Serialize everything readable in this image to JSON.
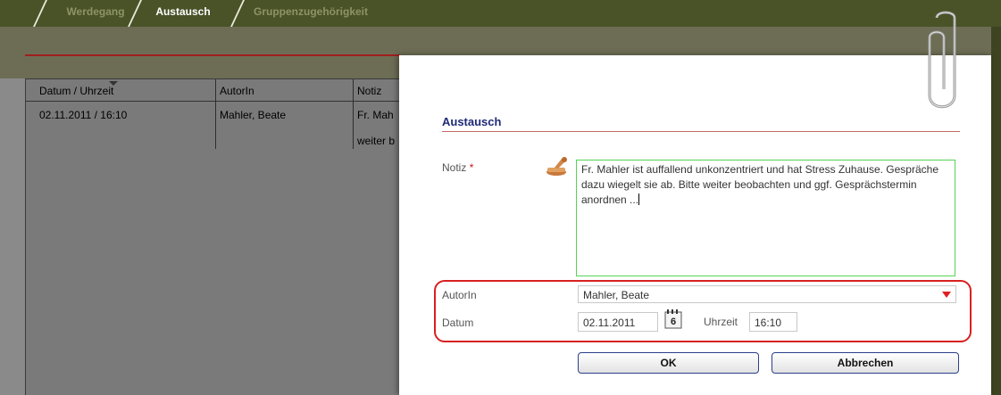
{
  "tabs": [
    {
      "label": "Werdegang"
    },
    {
      "label": "Austausch"
    },
    {
      "label": "Gruppenzugehörigkeit"
    }
  ],
  "list": {
    "columns": [
      "Datum / Uhrzeit",
      "AutorIn",
      "Notiz"
    ],
    "rows": [
      {
        "datetime": "02.11.2011 / 16:10",
        "author": "Mahler, Beate",
        "note_line1": "Fr. Mah",
        "note_line2": "weiter b"
      }
    ]
  },
  "dialog": {
    "title": "Austausch",
    "note_label": "Notiz",
    "required_mark": "*",
    "note_text": "Fr. Mahler ist auffallend unkonzentriert und hat Stress Zuhause. Gespräche dazu wiegelt sie ab. Bitte weiter beobachten und ggf. Gesprächstermin anordnen ...",
    "author_label": "AutorIn",
    "author_value": "Mahler, Beate",
    "date_label": "Datum",
    "date_value": "02.11.2011",
    "calendar_day": "6",
    "time_label": "Uhrzeit",
    "time_value": "16:10",
    "ok_label": "OK",
    "cancel_label": "Abbrechen"
  },
  "colors": {
    "tab_bar": "#4a5228",
    "accent_red": "#d82020",
    "title_blue": "#1f2a78",
    "note_border": "#55d455"
  },
  "icons": [
    "stamp-icon",
    "calendar-icon",
    "paperclip-icon",
    "dropdown-arrow-icon",
    "sort-arrow-icon"
  ]
}
